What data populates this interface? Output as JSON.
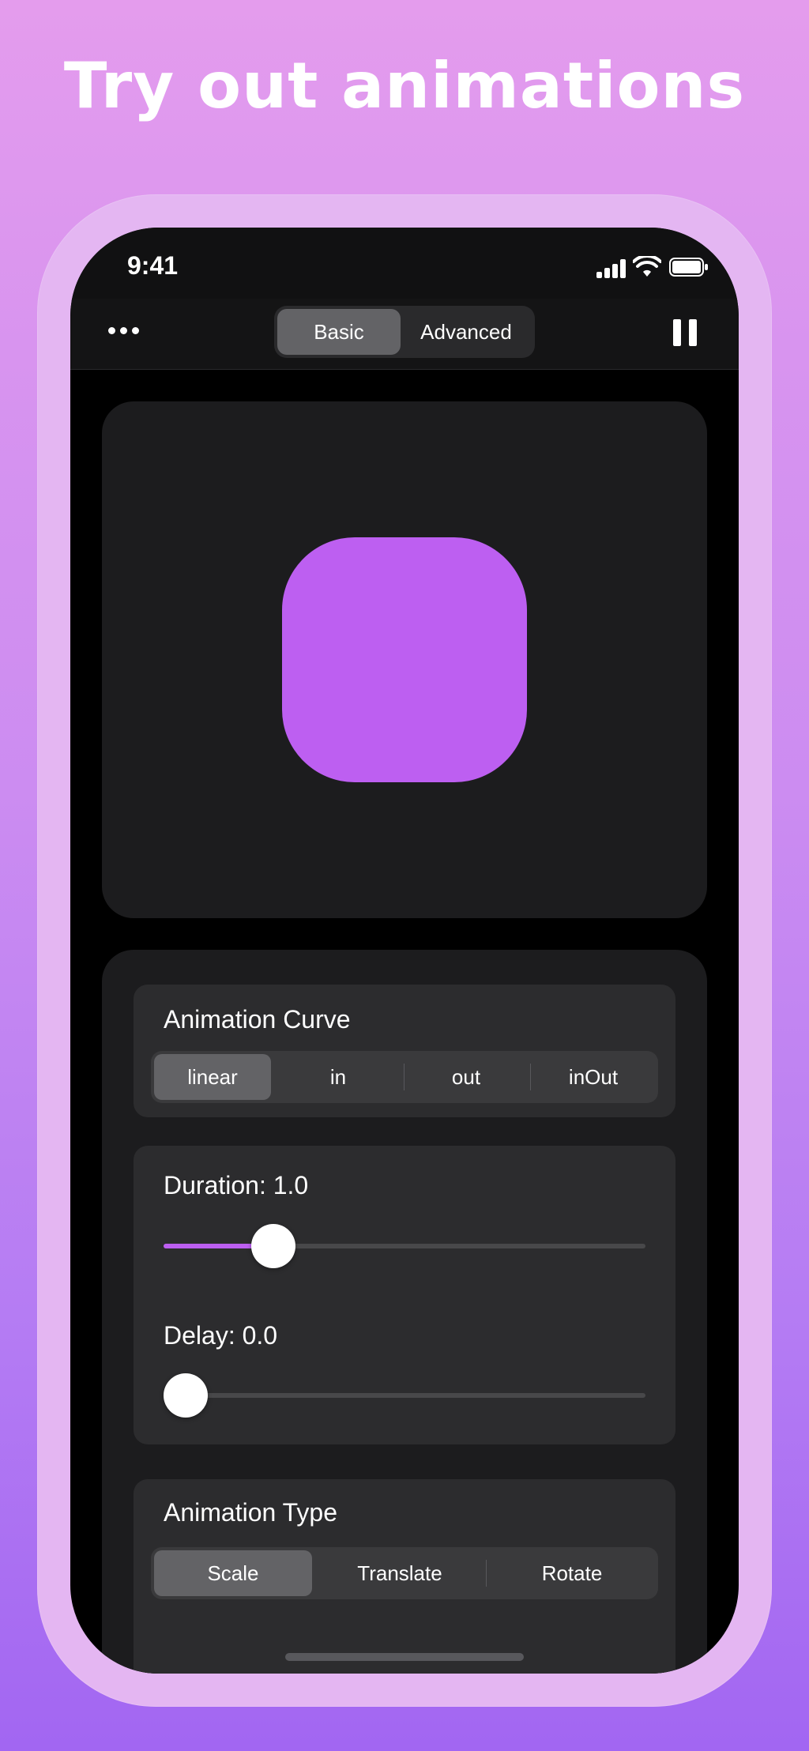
{
  "headline": "Try out animations",
  "status": {
    "time": "9:41"
  },
  "nav": {
    "more_icon": "ellipsis-icon",
    "tabs": [
      {
        "label": "Basic",
        "selected": true
      },
      {
        "label": "Advanced",
        "selected": false
      }
    ],
    "pause_icon": "pause-icon"
  },
  "preview": {
    "shape_color": "#bd5ff1"
  },
  "controls": {
    "curve": {
      "title": "Animation Curve",
      "options": [
        "linear",
        "in",
        "out",
        "inOut"
      ],
      "selected": "linear"
    },
    "duration": {
      "label": "Duration: 1.0",
      "value": 1.0,
      "fraction": 0.2
    },
    "delay": {
      "label": "Delay: 0.0",
      "value": 0.0,
      "fraction": 0.0
    },
    "type": {
      "title": "Animation Type",
      "options": [
        "Scale",
        "Translate",
        "Rotate"
      ],
      "selected": "Scale"
    }
  },
  "colors": {
    "accent": "#bd5ff1",
    "background_top": "#e49ced",
    "background_bottom": "#a266f2",
    "frame": "#e4b6f2"
  }
}
